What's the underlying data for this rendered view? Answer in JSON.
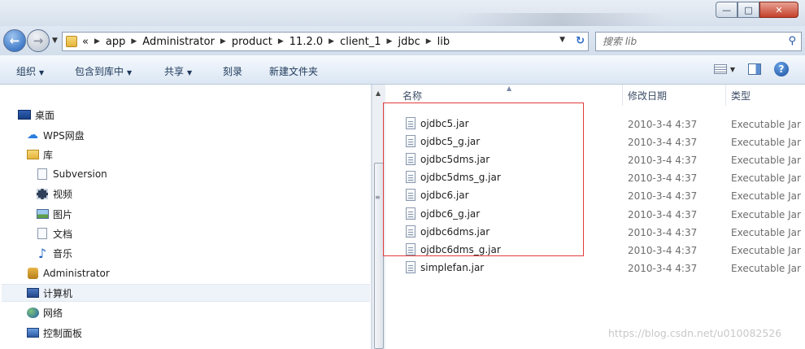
{
  "window": {
    "min_glyph": "—",
    "max_glyph": "□",
    "close_glyph": "✕"
  },
  "address": {
    "back_glyph": "←",
    "forward_glyph": "→",
    "crumb_lead": "«",
    "crumbs": [
      "app",
      "Administrator",
      "product",
      "11.2.0",
      "client_1",
      "jdbc",
      "lib"
    ],
    "search_placeholder": "搜索 lib"
  },
  "toolbar": {
    "organize": "组织",
    "include_library": "包含到库中",
    "share": "共享",
    "burn": "刻录",
    "new_folder": "新建文件夹"
  },
  "nav": {
    "desktop": "桌面",
    "wps": "WPS网盘",
    "library": "库",
    "subversion": "Subversion",
    "videos": "视频",
    "pictures": "图片",
    "documents": "文档",
    "music": "音乐",
    "administrator": "Administrator",
    "computer": "计算机",
    "network": "网络",
    "control_panel": "控制面板"
  },
  "columns": {
    "name": "名称",
    "modified": "修改日期",
    "type": "类型"
  },
  "files": [
    {
      "name": "ojdbc5.jar",
      "date": "2010-3-4 4:37",
      "type": "Executable Jar"
    },
    {
      "name": "ojdbc5_g.jar",
      "date": "2010-3-4 4:37",
      "type": "Executable Jar"
    },
    {
      "name": "ojdbc5dms.jar",
      "date": "2010-3-4 4:37",
      "type": "Executable Jar"
    },
    {
      "name": "ojdbc5dms_g.jar",
      "date": "2010-3-4 4:37",
      "type": "Executable Jar"
    },
    {
      "name": "ojdbc6.jar",
      "date": "2010-3-4 4:37",
      "type": "Executable Jar"
    },
    {
      "name": "ojdbc6_g.jar",
      "date": "2010-3-4 4:37",
      "type": "Executable Jar"
    },
    {
      "name": "ojdbc6dms.jar",
      "date": "2010-3-4 4:37",
      "type": "Executable Jar"
    },
    {
      "name": "ojdbc6dms_g.jar",
      "date": "2010-3-4 4:37",
      "type": "Executable Jar"
    },
    {
      "name": "simplefan.jar",
      "date": "2010-3-4 4:37",
      "type": "Executable Jar"
    }
  ],
  "watermark": "https://blog.csdn.net/u010082526",
  "colors": {
    "highlight_box": "#e23b3b",
    "toolbar_text": "#1e395b"
  }
}
